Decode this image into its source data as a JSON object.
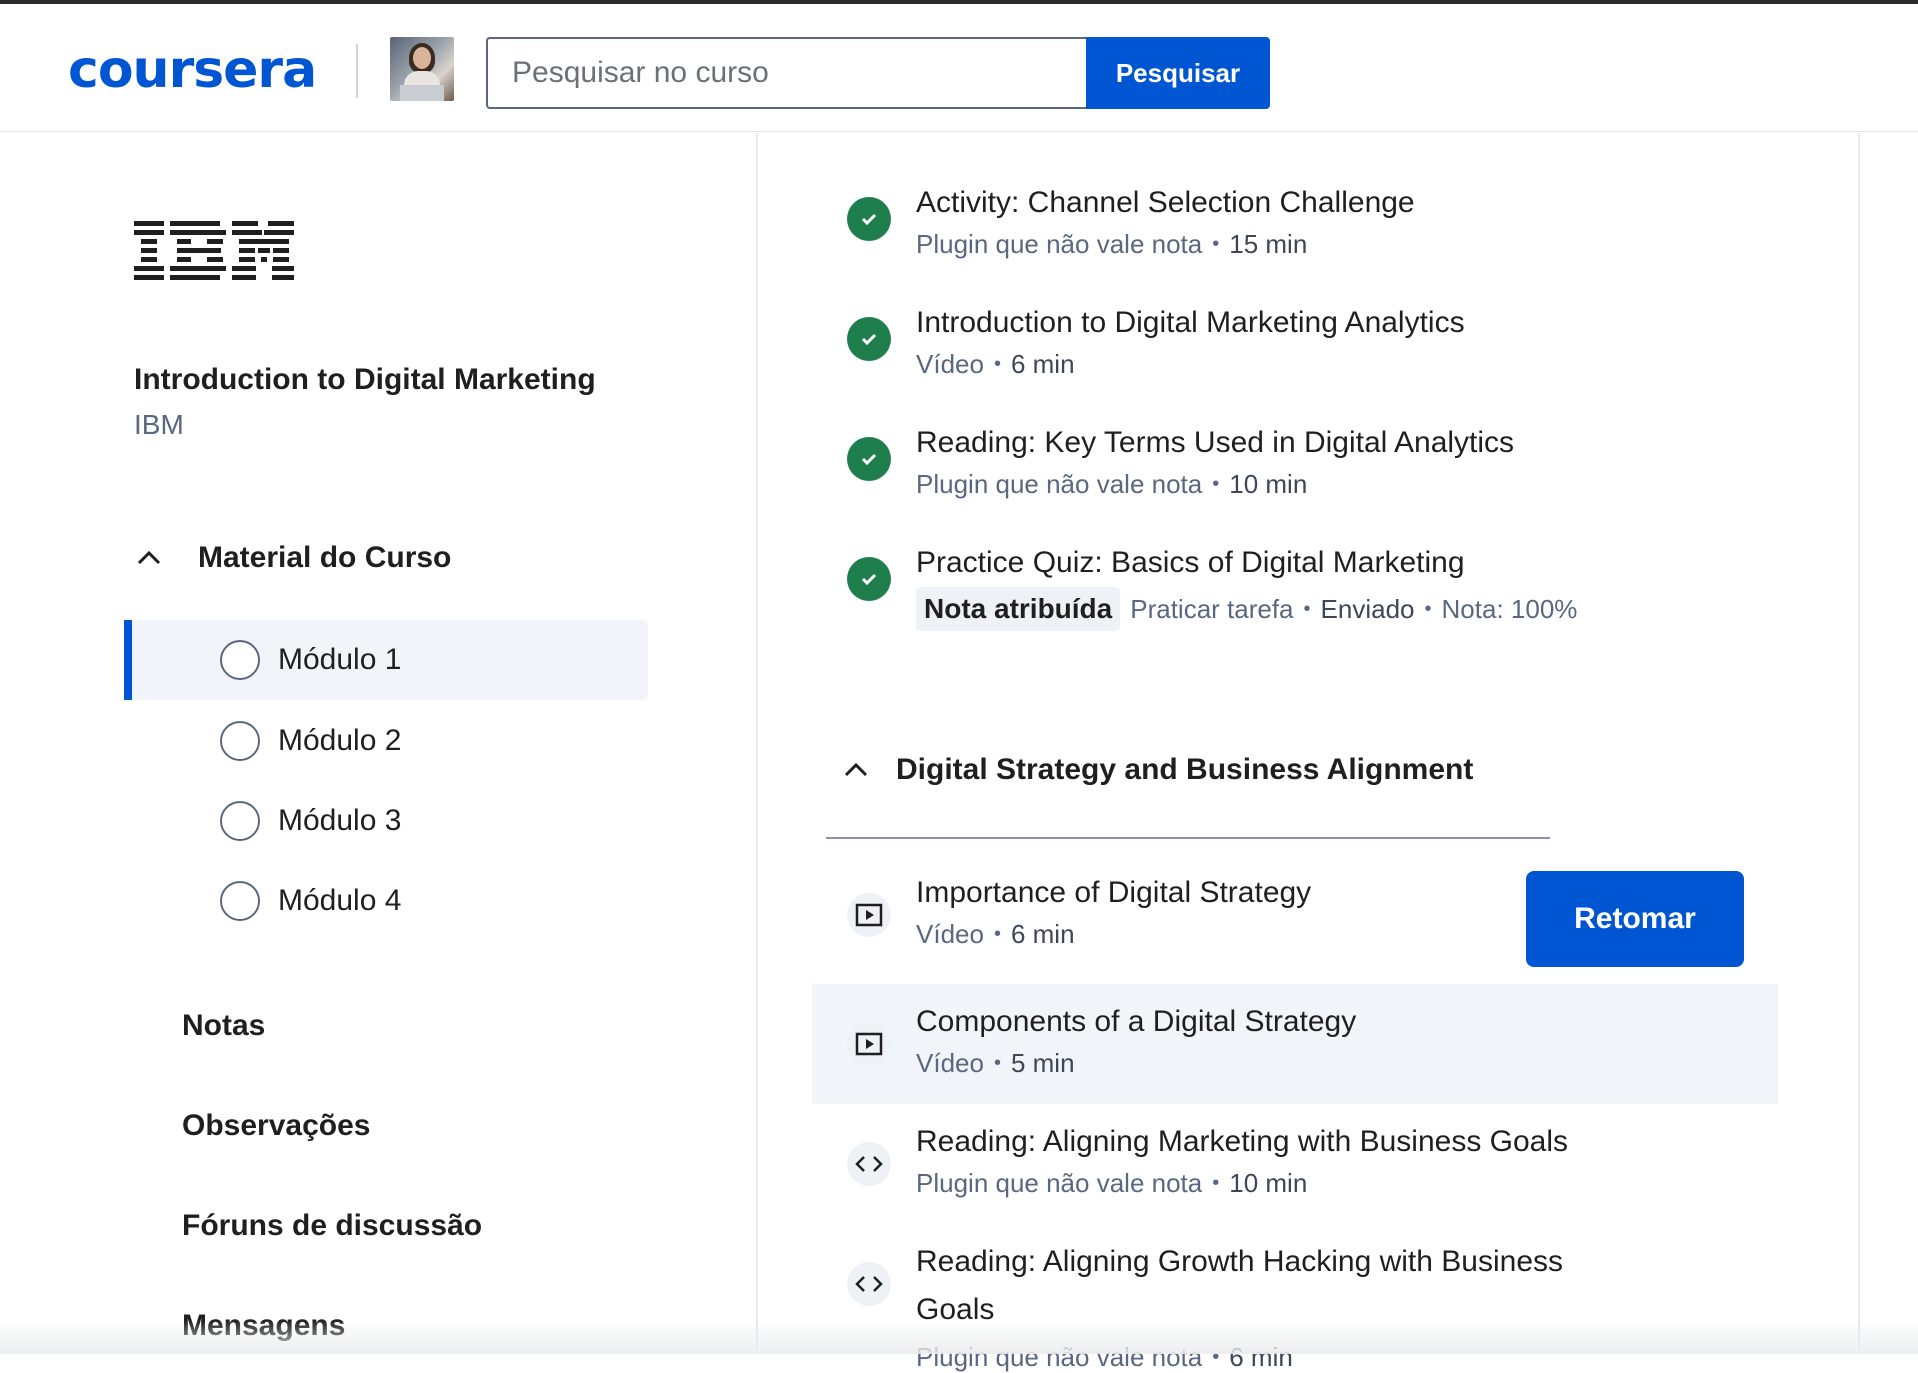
{
  "header": {
    "logo_text": "coursera",
    "search_placeholder": "Pesquisar no curso",
    "search_button": "Pesquisar"
  },
  "sidebar": {
    "org_logo": "IBM",
    "course_title": "Introduction to Digital Marketing",
    "course_org": "IBM",
    "section_label": "Material do Curso",
    "modules": [
      {
        "label": "Módulo 1",
        "active": true
      },
      {
        "label": "Módulo 2",
        "active": false
      },
      {
        "label": "Módulo 3",
        "active": false
      },
      {
        "label": "Módulo 4",
        "active": false
      }
    ],
    "links": [
      "Notas",
      "Observações",
      "Fóruns de discussão",
      "Mensagens"
    ]
  },
  "main": {
    "completed_items": [
      {
        "title": "Activity: Channel Selection Challenge",
        "type": "Plugin que não vale nota",
        "duration": "15 min"
      },
      {
        "title": "Introduction to Digital Marketing Analytics",
        "type": "Vídeo",
        "duration": "6 min"
      },
      {
        "title": "Reading: Key Terms Used in Digital Analytics",
        "type": "Plugin que não vale nota",
        "duration": "10 min"
      },
      {
        "title": "Practice Quiz: Basics of Digital Marketing",
        "badge": "Nota atribuída",
        "type": "Praticar tarefa",
        "status": "Enviado",
        "grade": "Nota: 100%"
      }
    ],
    "group_title": "Digital Strategy and Business Alignment",
    "resume_button": "Retomar",
    "group_items": [
      {
        "title": "Importance of Digital Strategy",
        "type": "Vídeo",
        "duration": "6 min",
        "icon": "video-icon"
      },
      {
        "title": "Components of a Digital Strategy",
        "type": "Vídeo",
        "duration": "5 min",
        "icon": "video-icon"
      },
      {
        "title": "Reading: Aligning Marketing with Business Goals",
        "type": "Plugin que não vale nota",
        "duration": "10 min",
        "icon": "code-icon"
      },
      {
        "title_line1": "Reading: Aligning Growth Hacking with Business",
        "title_line2": "Goals",
        "type": "Plugin que não vale nota",
        "duration": "6 min",
        "icon": "code-icon"
      }
    ]
  },
  "colors": {
    "brand": "#0056d2",
    "complete": "#1f7f4c",
    "muted": "#5b6780"
  }
}
